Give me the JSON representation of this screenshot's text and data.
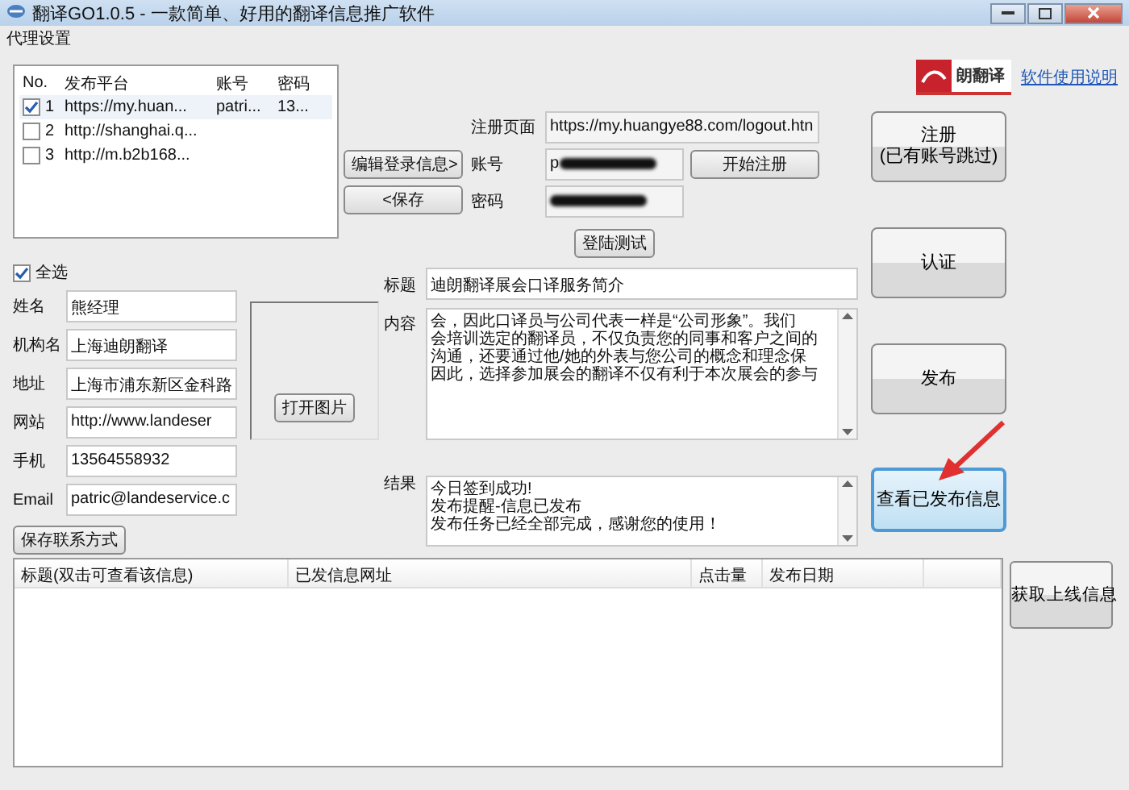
{
  "window": {
    "title": "翻译GO1.0.5 - 一款简单、好用的翻译信息推广软件"
  },
  "menu": [
    "代理设置"
  ],
  "platforms": {
    "columns": [
      "No.",
      "发布平台",
      "账号",
      "密码"
    ],
    "rows": [
      {
        "checked": true,
        "selected": true,
        "no": "1",
        "platform": "https://my.huan...",
        "account": "patri...",
        "password": "13..."
      },
      {
        "checked": false,
        "selected": false,
        "no": "2",
        "platform": "http://shanghai.q..."
      },
      {
        "checked": false,
        "selected": false,
        "no": "3",
        "platform": "http://m.b2b168..."
      }
    ]
  },
  "select_all": {
    "label": "全选",
    "checked": true
  },
  "contact": {
    "fields": [
      {
        "label": "姓名",
        "value": "熊经理"
      },
      {
        "label": "机构名",
        "value": "上海迪朗翻译"
      },
      {
        "label": "地址",
        "value": "上海市浦东新区金科路"
      },
      {
        "label": "网站",
        "value": "http://www.landeser"
      },
      {
        "label": "手机",
        "value": "13564558932"
      },
      {
        "label": "Email",
        "value": "patric@landeservice.c"
      }
    ],
    "save_button": "保存联系方式"
  },
  "picture_box": {
    "button": "打开图片"
  },
  "edit_buttons": [
    "编辑登录信息>",
    "<保存"
  ],
  "registration": {
    "page_label": "注册页面",
    "page_url": "https://my.huangye88.com/logout.htn",
    "account_label": "账号",
    "account_value": "p",
    "password_label": "密码",
    "start_button": "开始注册",
    "test_button": "登陆测试"
  },
  "post": {
    "title_label": "标题",
    "title_value": "迪朗翻译展会口译服务简介",
    "content_label": "内容",
    "content_lines": [
      "会，因此口译员与公司代表一样是“公司形象”。我们",
      "会培训选定的翻译员，不仅负责您的同事和客户之间的",
      "沟通，还要通过他/她的外表与您公司的概念和理念保",
      "因此，选择参加展会的翻译不仅有利于本次展会的参与"
    ],
    "result_label": "结果",
    "result_lines": [
      "今日签到成功!",
      "发布提醒-信息已发布",
      "发布任务已经全部完成，感谢您的使用！"
    ]
  },
  "logo": {
    "text": "朗翻译"
  },
  "help_link": "软件使用说明",
  "actions": [
    {
      "lines": [
        "注册",
        "(已有账号跳过)"
      ],
      "highlighted": false
    },
    {
      "lines": [
        "认证"
      ],
      "highlighted": false
    },
    {
      "lines": [
        "发布"
      ],
      "highlighted": false
    },
    {
      "lines": [
        "查看已发布信息"
      ],
      "highlighted": true
    }
  ],
  "published_table": {
    "columns": [
      "标题(双击可查看该信息)",
      "已发信息网址",
      "点击量",
      "发布日期"
    ]
  },
  "fetch_button": "获取上线信息"
}
